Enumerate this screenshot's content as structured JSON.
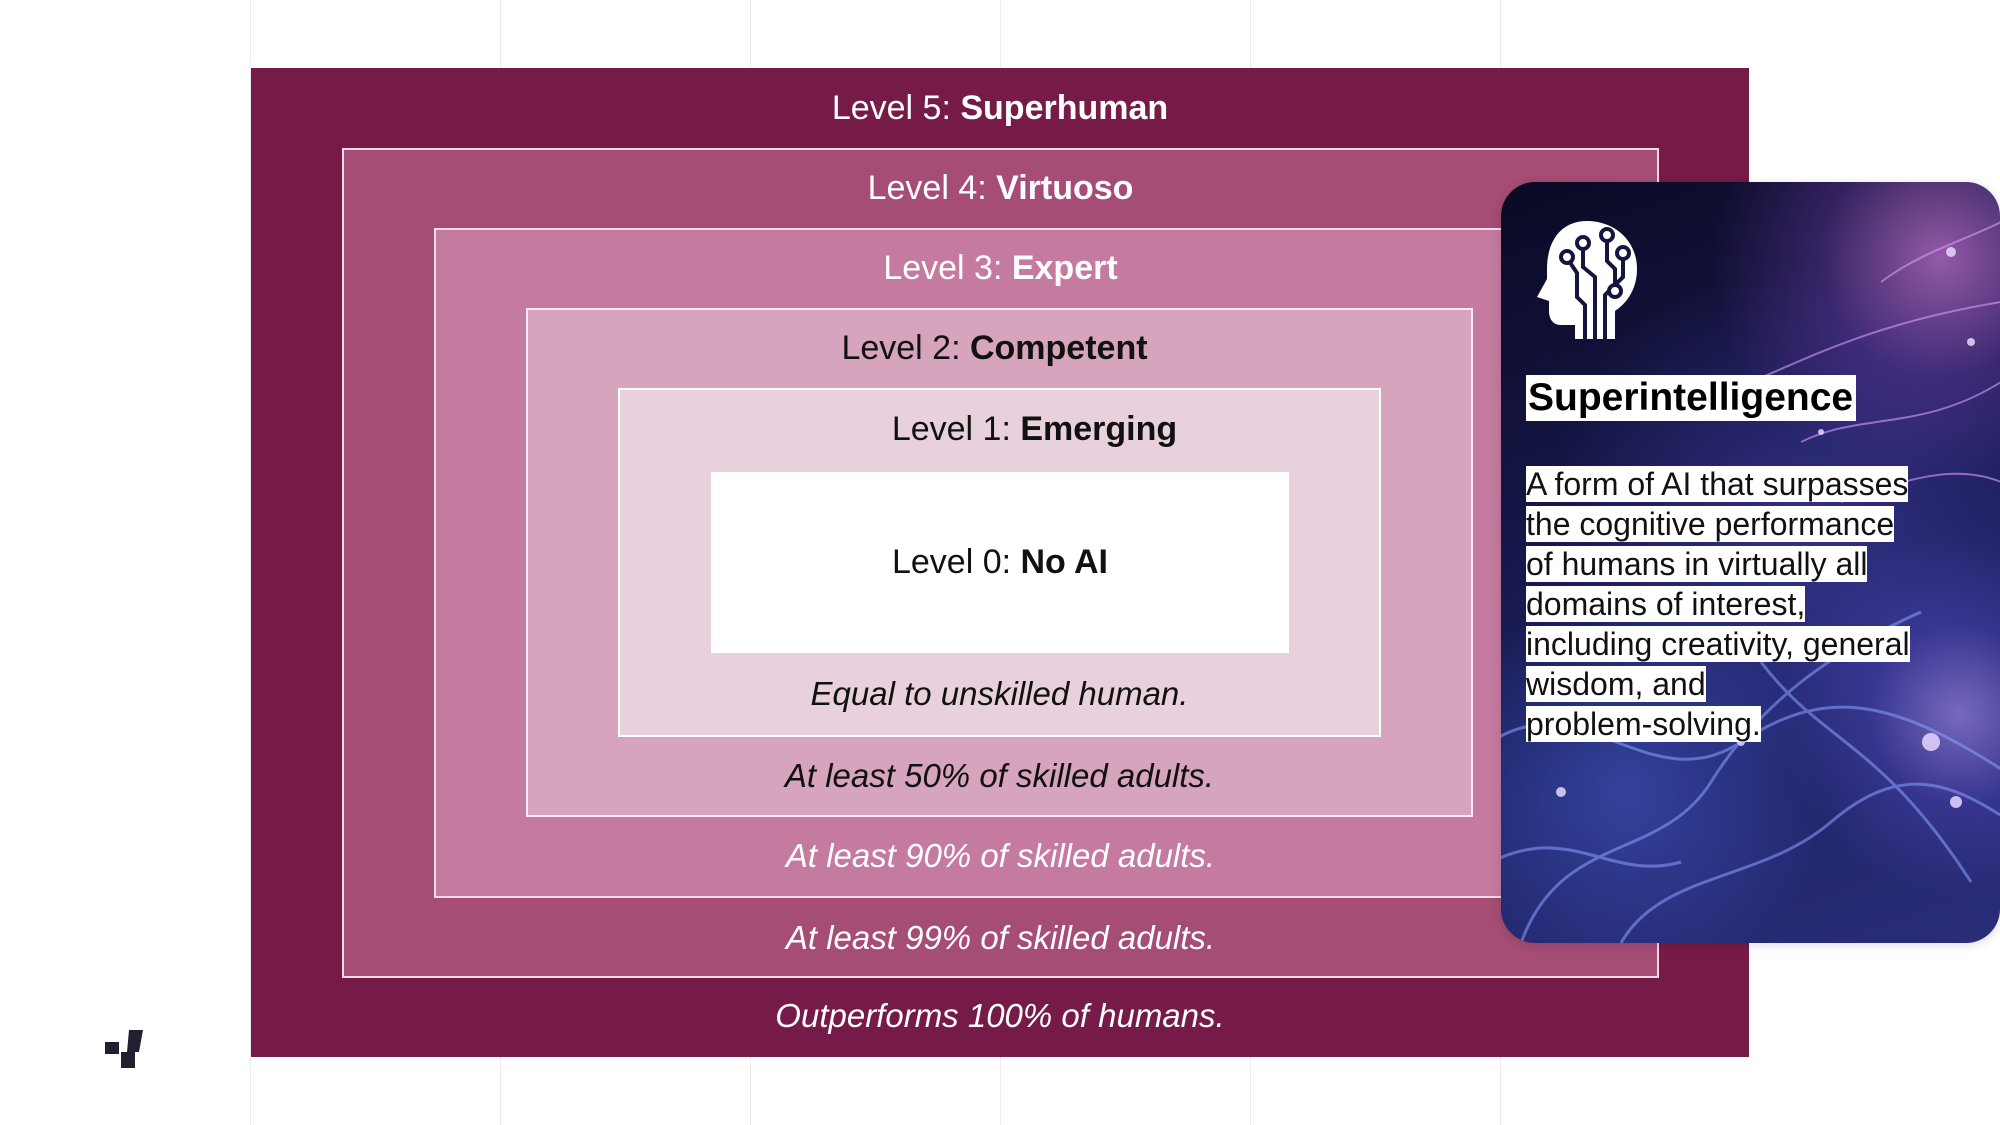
{
  "levels": [
    {
      "prefix": "Level 5: ",
      "name": "Superhuman",
      "description": "Outperforms 100% of humans."
    },
    {
      "prefix": "Level 4: ",
      "name": "Virtuoso",
      "description": "At least 99% of skilled adults."
    },
    {
      "prefix": "Level 3: ",
      "name": "Expert",
      "description": "At least 90% of skilled adults."
    },
    {
      "prefix": "Level 2: ",
      "name": "Competent",
      "description": "At least 50% of skilled adults."
    },
    {
      "prefix": "Level 1: ",
      "name": "Emerging",
      "description": "Equal to unskilled human."
    },
    {
      "prefix": "Level 0: ",
      "name": "No AI"
    }
  ],
  "card": {
    "icon": "ai-head-circuit-icon",
    "title": "Superintelligence",
    "lines": [
      "A form of AI that surpasses",
      "the cognitive performance",
      "of humans in virtually all",
      "domains of interest,",
      "including creativity, general",
      "wisdom, and",
      "problem-solving."
    ]
  },
  "colors": {
    "level5": "#761b47",
    "level4": "#a54d74",
    "level3": "#c57b9f",
    "level2": "#d6a4bd",
    "level1": "#e8d1dd",
    "level0": "#ffffff"
  },
  "logo": "brand-logo-icon"
}
